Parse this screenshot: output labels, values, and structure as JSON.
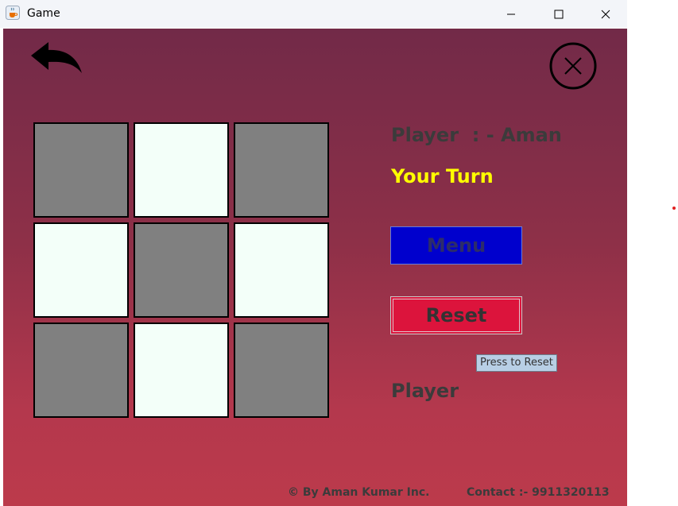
{
  "window": {
    "title": "Game",
    "icon": "java-cup-icon"
  },
  "titlebar_buttons": {
    "minimize": "minimize-icon",
    "maximize": "maximize-icon",
    "close": "close-icon"
  },
  "game": {
    "back_icon": "back-arrow-icon",
    "close_icon": "circle-close-icon",
    "board": {
      "cells": [
        {
          "state": "dark"
        },
        {
          "state": "light"
        },
        {
          "state": "dark"
        },
        {
          "state": "light"
        },
        {
          "state": "dark"
        },
        {
          "state": "light"
        },
        {
          "state": "dark"
        },
        {
          "state": "light"
        },
        {
          "state": "dark"
        }
      ]
    },
    "player_label": "Player  : - Aman",
    "turn_label": "Your Turn",
    "menu_label": "Menu",
    "reset_label": "Reset",
    "reset_tooltip": "Press to Reset",
    "player2_label": "Player"
  },
  "footer": {
    "copyright": "© By Aman Kumar Inc.",
    "contact": "Contact :- 9911320113"
  },
  "colors": {
    "bg_top": "#722a48",
    "bg_bottom": "#bc3a4b",
    "cell_dark": "#808080",
    "cell_light": "#f3fff9",
    "turn_text": "#ffff00",
    "menu_bg": "#0000cd",
    "reset_bg": "#dc143c"
  }
}
